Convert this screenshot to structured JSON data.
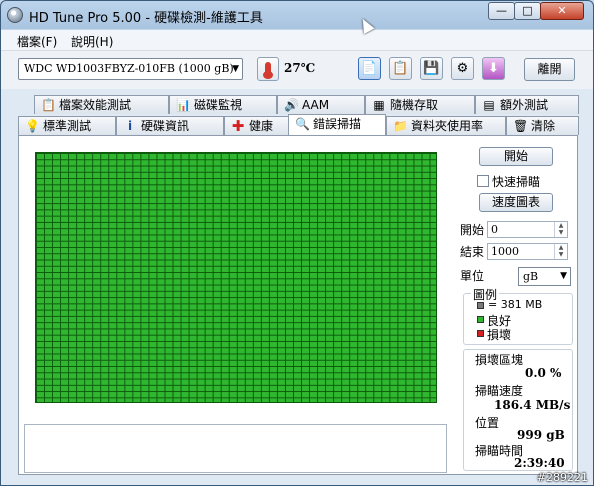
{
  "window": {
    "title": "HD Tune Pro  5.00 - 硬碟檢測-維護工具",
    "min_label": "—",
    "max_label": "□",
    "close_label": "✕"
  },
  "menu": [
    "檔案(F)",
    "說明(H)"
  ],
  "toolbar": {
    "drive": "WDC    WD1003FBYZ-010FB (1000 gB)",
    "temperature": "27℃",
    "exit_label": "離開"
  },
  "tabs_top": [
    {
      "label": "檔案效能測試",
      "icon": "file-benchmark-icon"
    },
    {
      "label": "磁碟監視",
      "icon": "disk-monitor-icon"
    },
    {
      "label": "AAM",
      "icon": "speaker-icon"
    },
    {
      "label": "隨機存取",
      "icon": "random-access-icon"
    },
    {
      "label": "額外測試",
      "icon": "extra-tests-icon"
    }
  ],
  "tabs_bottom": [
    {
      "label": "標準測試",
      "icon": "benchmark-icon"
    },
    {
      "label": "硬碟資訊",
      "icon": "info-icon"
    },
    {
      "label": "健康",
      "icon": "health-cross-icon"
    },
    {
      "label": "錯誤掃描",
      "icon": "magnifier-icon",
      "selected": true
    },
    {
      "label": "資料夾使用率",
      "icon": "folder-icon"
    },
    {
      "label": "清除",
      "icon": "trash-icon"
    }
  ],
  "scan": {
    "start_button": "開始",
    "quick_scan_label": "快速掃瞄",
    "quick_scan_checked": false,
    "speed_map_button": "速度圖表",
    "start_label": "開始",
    "start_value": "0",
    "end_label": "結束",
    "end_value": "1000",
    "unit_label": "單位",
    "unit_value": "gB"
  },
  "legend": {
    "title": "圖例",
    "items": [
      {
        "label": "= 381 MB",
        "color": "#7a7a7a"
      },
      {
        "label": "良好",
        "color": "#2fb82f"
      },
      {
        "label": "損壞",
        "color": "#d42020"
      }
    ]
  },
  "stats": {
    "damaged_blocks_label": "損壞區塊",
    "damaged_blocks_value": "0.0 %",
    "scan_speed_label": "掃瞄速度",
    "scan_speed_value": "186.4 MB/s",
    "position_label": "位置",
    "position_value": "999 gB",
    "scan_time_label": "掃瞄時間",
    "scan_time_value": "2:39:40"
  },
  "grid": {
    "status": "all blocks good",
    "color_good": "#2fb82f"
  },
  "watermark": "#289221"
}
